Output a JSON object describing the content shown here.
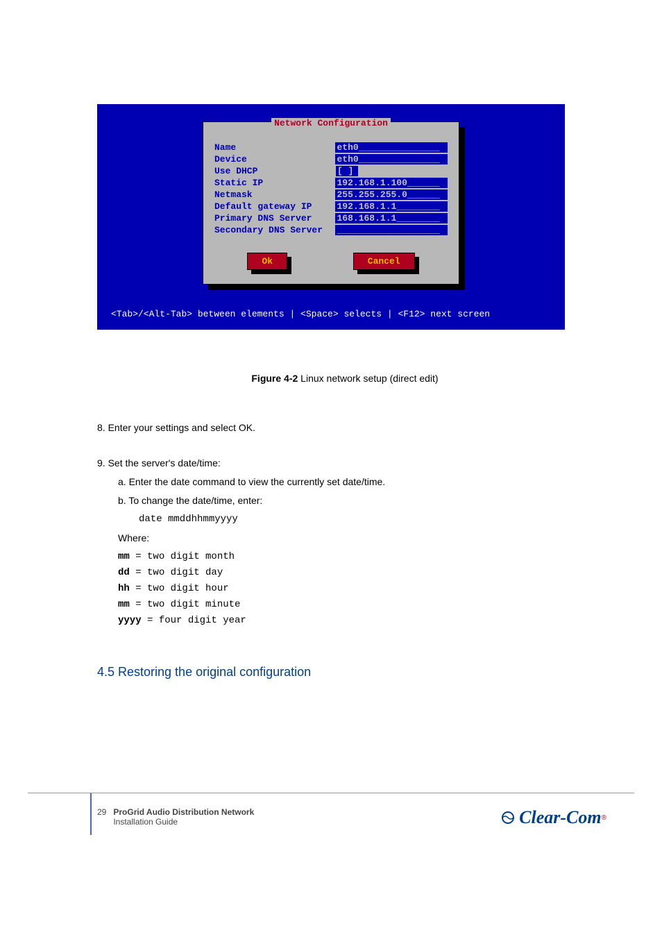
{
  "terminal": {
    "title": "Network Configuration",
    "fields": [
      {
        "label": "Name",
        "value": "eth0_______________"
      },
      {
        "label": "Device",
        "value": "eth0_______________"
      },
      {
        "label": "Use DHCP",
        "value": "[ ]"
      },
      {
        "label": "Static IP",
        "value": "192.168.1.100______"
      },
      {
        "label": "Netmask",
        "value": "255.255.255.0______"
      },
      {
        "label": "Default gateway IP",
        "value": "192.168.1.1________"
      },
      {
        "label": "Primary DNS Server",
        "value": "168.168.1.1________"
      },
      {
        "label": "Secondary DNS Server",
        "value": "___________________"
      }
    ],
    "buttons": {
      "ok": "Ok",
      "cancel": "Cancel"
    },
    "footer": "<Tab>/<Alt-Tab> between elements   |   <Space> selects   |   <F12> next screen"
  },
  "caption": {
    "label": "Figure 4-2",
    "text": "Linux network setup (direct edit)"
  },
  "steps": {
    "step8": "8.   Enter your settings and select OK.",
    "step9a": "9.   Set the server's date/time:",
    "step9b": "a.  Enter the date command to view the currently set date/time.",
    "step9c": "b.  To change the date/time, enter:",
    "dateCmd": "date mmddhhmmyyyy",
    "where": "Where:",
    "legend": [
      {
        "code": "mm",
        "desc": " = two digit month"
      },
      {
        "code": "dd",
        "desc": " = two digit day"
      },
      {
        "code": "hh",
        "desc": " = two digit hour"
      },
      {
        "code": "mm",
        "desc": " = two digit minute"
      },
      {
        "code": "yyyy",
        "desc": " = four digit year"
      }
    ]
  },
  "section": "4.5  Restoring the original configuration",
  "pageFooter": {
    "num": "29",
    "title": "ProGrid Audio Distribution Network",
    "sub": "Installation Guide"
  },
  "logoText": "Clear-Com"
}
